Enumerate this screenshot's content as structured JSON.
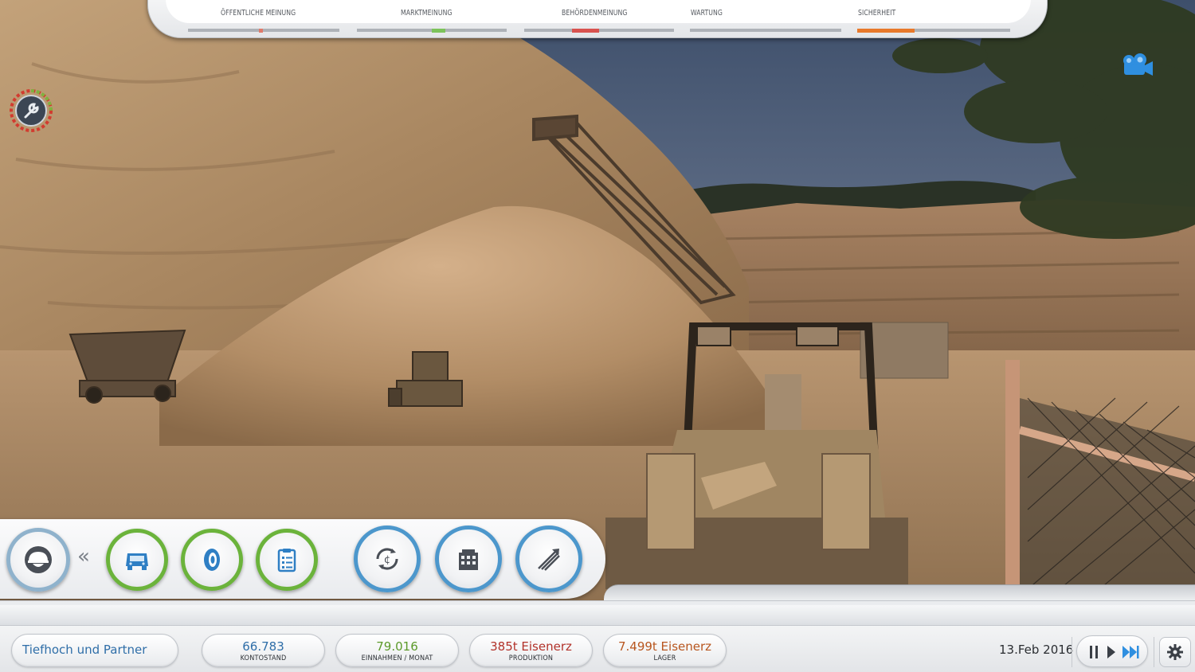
{
  "meters": [
    {
      "label": "ÖFFENTLICHE MEINUNG",
      "marker_color": "#e07a6a",
      "level": 0.48
    },
    {
      "label": "MARKTMEINUNG",
      "marker_color": "#7dc35b",
      "level": 0.5
    },
    {
      "label": "BEHÖRDENMEINUNG",
      "marker_color": "#d9534f",
      "level": 0.35
    },
    {
      "label": "WARTUNG",
      "marker_color": "#9aa0a6",
      "level": 0.0
    },
    {
      "label": "SICHERHEIT",
      "marker_color": "#e8792b",
      "level": 0.37
    }
  ],
  "toolbar": {
    "collapse_glyph": "«",
    "buttons": [
      {
        "icon": "helmet-icon",
        "group": "personnel"
      },
      {
        "icon": "truck-icon",
        "group": "vehicles"
      },
      {
        "icon": "tire-icon",
        "group": "equipment"
      },
      {
        "icon": "clipboard-icon",
        "group": "contracts"
      },
      {
        "icon": "currency-cycle-icon",
        "group": "finance"
      },
      {
        "icon": "building-icon",
        "group": "buildings"
      },
      {
        "icon": "growth-arrows-icon",
        "group": "statistics"
      }
    ]
  },
  "status": {
    "company": "Tiefhoch und Partner",
    "balance": {
      "value": "66.783",
      "label": "KONTOSTAND",
      "color": "#2f6ea8"
    },
    "income": {
      "value": "79.016",
      "label": "EINNAHMEN / MONAT",
      "color": "#5c9a2a"
    },
    "production": {
      "value": "385t Eisenerz",
      "label": "PRODUKTION",
      "color": "#b2322a"
    },
    "storage": {
      "value": "7.499t Eisenerz",
      "label": "LAGER",
      "color": "#b8561f"
    },
    "date": "13.Feb 2016"
  },
  "colors": {
    "accent_blue": "#2f8fe0",
    "button_green": "#6bb33b",
    "button_blue": "#4c97cc"
  }
}
